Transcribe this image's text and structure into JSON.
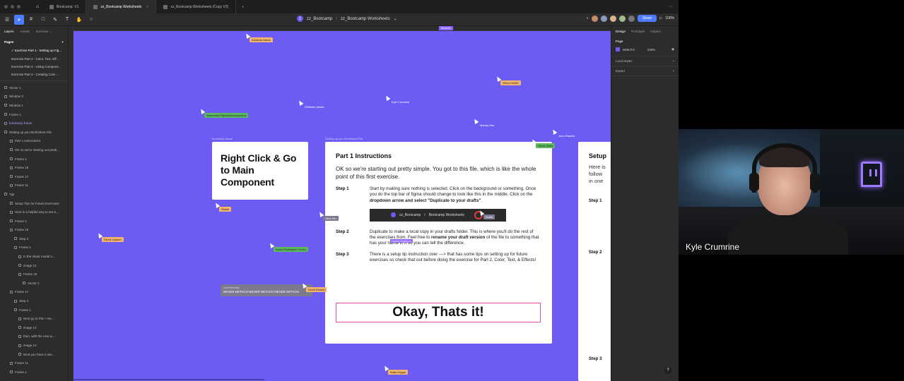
{
  "tabs": {
    "items": [
      {
        "label": "Bootcamp: V1",
        "active": false
      },
      {
        "label": "zz_Bootcamp Worksheets",
        "active": true
      },
      {
        "label": "zz_Bootcamp Worksheets (Copy V2)",
        "active": false
      }
    ],
    "plus": "+",
    "more": "···"
  },
  "toolbar": {
    "team": "zz_Bootcamp",
    "separator": "/",
    "file": "zz_Bootcamp Worksheets",
    "file_chevron": "⌄",
    "share_label": "Share",
    "play": "▷",
    "zoom": "100%"
  },
  "left_panel": {
    "tabs": [
      "Layers",
      "Assets",
      "Exercise ⌄"
    ],
    "pages_label": "Pages",
    "pages_add": "+",
    "pages": [
      "✓ Exercise Part 1 - Setting up Fig…",
      "Exercise Part 2 - Color, Text, Eff…",
      "Exercise Part 3 - Using Compone…",
      "Exercise Part 4 - Creating Com…"
    ],
    "layers": [
      "Vector 1",
      "Window 3",
      "Window 1",
      "Frame 1",
      "bootcamp frame",
      "Setting up you Worksheet File",
      "Part 1 Instructions",
      "OK so we're starting out pretti…",
      "Frame 1",
      "Frame 15",
      "Frame 17",
      "Frame 11",
      "Tip!",
      "Setup Tips for Future Exercises",
      "Here is a helpful way to set a…",
      "Frame 1",
      "Frame 15",
      "Step 3",
      "Frame 1",
      "In the share modal s…",
      "image 13",
      "Frame 16",
      "Vector 2",
      "Frame 17",
      "Step 3",
      "Frame 1",
      "Next go to File > Ne…",
      "image 14",
      "then, with the new w…",
      "image 13",
      "Next you have 2 win…",
      "Frame 11",
      "Frame 1"
    ]
  },
  "ruler": {
    "badge": "Bounds"
  },
  "right_panel": {
    "tabs": [
      "Design",
      "Prototype",
      "Inspect"
    ],
    "page_label": "Page",
    "bg_hex": "6D5CF4",
    "bg_opacity": "100%",
    "local_styles": "Local styles",
    "export": "Export",
    "add": "+",
    "eye": "◉"
  },
  "canvas": {
    "bg_color": "#6d5cf4",
    "frame_labels": {
      "f1": "bootcamp frame",
      "f2": "Setting up you Worksheet File"
    },
    "frame1_title": "Right Click & Go to Main Component",
    "frame2": {
      "heading": "Part 1 Instructions",
      "lead": "OK so we're starting out pretty simple. You got to this file, which is like the whole point of this first exercise.",
      "steps": [
        {
          "label": "Step 1",
          "text": "Start by making sure nothing is selected. Click on the background or something. Once you do the top bar of figma should change to look like this in the middle. Click on the dropdown arrow and select \"Duplicate to your drafts\"."
        },
        {
          "label": "Step 2",
          "text": "Duplicate to make a local copy in your drafts folder. This is where you'll do the rest of the exercises from. Feel free to rename your draft version of the file to something that has your name in it so you can tell the difference."
        },
        {
          "label": "Step 3",
          "text": "There is a setup tip instruction over ---> that has some tips on setting up for future exercises so check that out before doing the exercise for Part 2, Color, Text, & Effects!"
        }
      ],
      "mock_bar": {
        "team": "zz_Bootcamp",
        "sep": "/",
        "file": "Bootcamp Worksheets"
      },
      "okay": "Okay, Thats it!"
    },
    "frame3": {
      "heading": "Setup",
      "lead_lines": [
        "Here is",
        "follow",
        "in one"
      ],
      "steps": [
        "Step 1",
        "Step 2",
        "Step 3"
      ]
    },
    "hover_tag": "Daniel Muldoon",
    "chat": {
      "name": "Liam Kennedy",
      "text": "NEVER DETACH NEVER DETACH NEVER DETACH"
    },
    "cursors": [
      {
        "name": "Amanda Harris",
        "color": "#f2b36b"
      },
      {
        "name": "Viktor Hoblin",
        "color": "#f2b36b"
      },
      {
        "name": "Kyle Crumrine",
        "color": "#6d5cf4"
      },
      {
        "name": "Shibhika Savita",
        "color": "#6d5cf4"
      },
      {
        "name": "Samantha Papamichaelopoulos",
        "color": "#5cb85c"
      },
      {
        "name": "Mandy Han",
        "color": "#6d5cf4"
      },
      {
        "name": "John Elswick",
        "color": "#6d5cf4"
      },
      {
        "name": "Oliver Hicks",
        "color": "#5cb85c"
      },
      {
        "name": "Shasti",
        "color": "#f2b36b"
      },
      {
        "name": "Jane Wu",
        "color": "#7c7a8e"
      },
      {
        "name": "Derek Lassen",
        "color": "#f2b36b"
      },
      {
        "name": "Andre Rodriguez Cortes",
        "color": "#5cb85c"
      },
      {
        "name": "Kevin Bustos",
        "color": "#f2b36b"
      },
      {
        "name": "Katie Hogan",
        "color": "#f2b36b"
      },
      {
        "name": "Bodie",
        "color": "#7c7a8e"
      }
    ]
  },
  "webcam": {
    "name": "Kyle Crumrine"
  }
}
